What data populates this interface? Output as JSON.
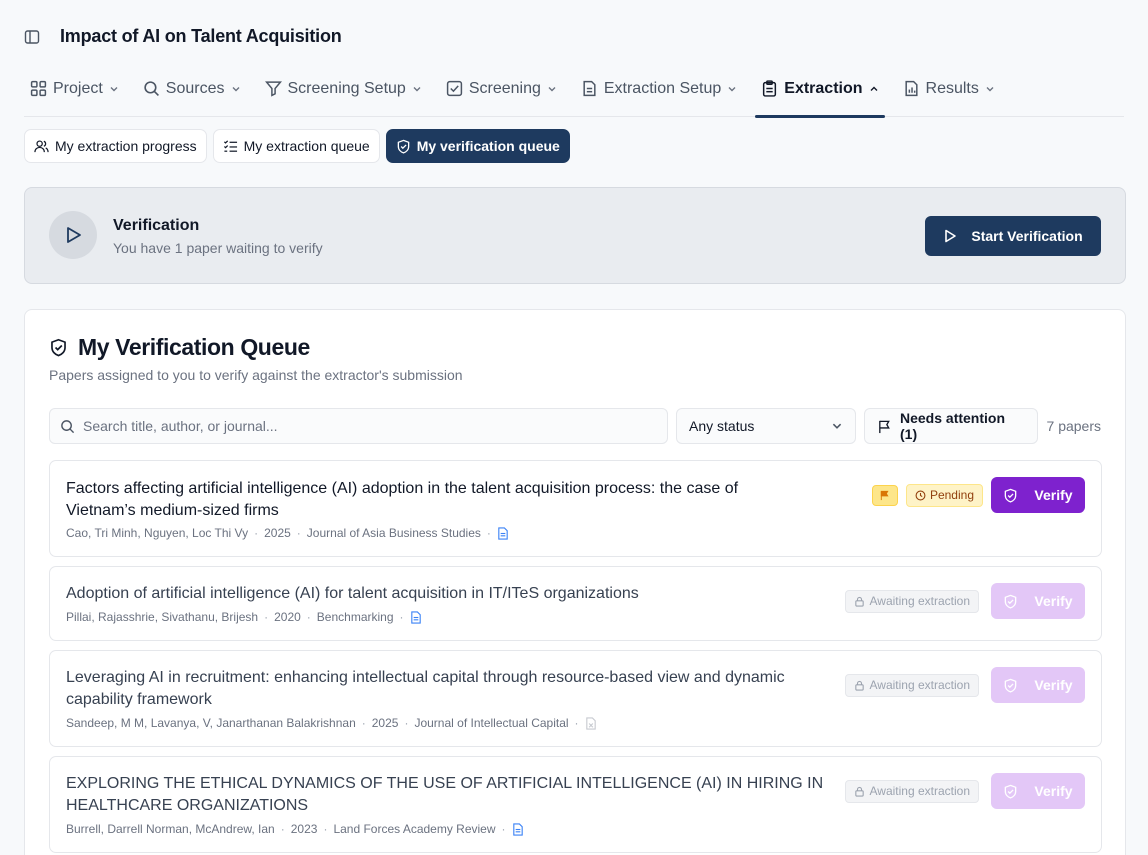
{
  "header": {
    "title": "Impact of AI on Talent Acquisition"
  },
  "nav": {
    "tabs": [
      {
        "label": "Project",
        "icon": "grid-icon"
      },
      {
        "label": "Sources",
        "icon": "search-icon"
      },
      {
        "label": "Screening Setup",
        "icon": "filter-icon"
      },
      {
        "label": "Screening",
        "icon": "checkbox-icon"
      },
      {
        "label": "Extraction Setup",
        "icon": "document-icon"
      },
      {
        "label": "Extraction",
        "icon": "clipboard-icon",
        "active": true
      },
      {
        "label": "Results",
        "icon": "report-icon"
      }
    ]
  },
  "subtabs": {
    "progress": "My extraction progress",
    "queue": "My extraction queue",
    "verification": "My verification queue"
  },
  "banner": {
    "title": "Verification",
    "subtitle": "You have 1 paper waiting to verify",
    "button": "Start Verification"
  },
  "queue": {
    "title": "My Verification Queue",
    "subtitle": "Papers assigned to you to verify against the extractor's submission",
    "search_placeholder": "Search title, author, or journal...",
    "status_select": "Any status",
    "attention_button": "Needs attention (1)",
    "paper_count": "7 papers",
    "verify_label": "Verify",
    "pending_label": "Pending",
    "awaiting_label": "Awaiting extraction",
    "papers": [
      {
        "title_line1": "Factors affecting artificial intelligence (AI) adoption in the talent acquisition process: the case of",
        "title_line2": "Vietnam’s medium-sized firms",
        "authors": "Cao, Tri Minh, Nguyen, Loc Thi Vy",
        "year": "2025",
        "journal": "Journal of Asia Business Studies",
        "status": "pending",
        "flagged": true
      },
      {
        "title_line1": "Adoption of artificial intelligence (AI) for talent acquisition in IT/ITeS organizations",
        "title_line2": "",
        "authors": "Pillai, Rajasshrie, Sivathanu, Brijesh",
        "year": "2020",
        "journal": "Benchmarking",
        "status": "awaiting"
      },
      {
        "title_line1": "Leveraging AI in recruitment: enhancing intellectual capital through resource-based view and dynamic",
        "title_line2": "capability framework",
        "authors": "Sandeep, M M, Lavanya, V, Janarthanan Balakrishnan",
        "year": "2025",
        "journal": "Journal of Intellectual Capital",
        "status": "awaiting"
      },
      {
        "title_line1": "EXPLORING THE ETHICAL DYNAMICS OF THE USE OF ARTIFICIAL INTELLIGENCE (AI) IN HIRING IN",
        "title_line2": "HEALTHCARE ORGANIZATIONS",
        "authors": "Burrell, Darrell Norman, McAndrew, Ian",
        "year": "2023",
        "journal": "Land Forces Academy Review",
        "status": "awaiting"
      }
    ]
  },
  "colors": {
    "primary_navy": "#1e3a5f",
    "verify_purple": "#7e22ce",
    "verify_disabled": "#e3c7f7",
    "pending_bg": "#fef3c7",
    "flag_yellow": "#fde68a"
  }
}
